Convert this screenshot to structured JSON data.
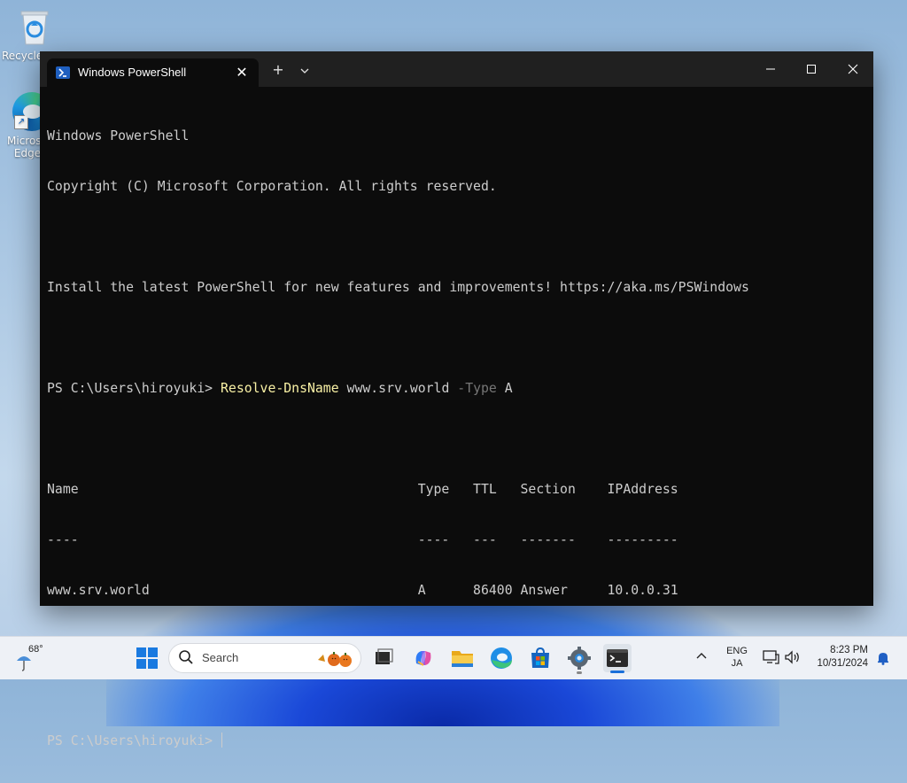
{
  "desktop": {
    "icons": [
      {
        "label": "Recycle Bin"
      },
      {
        "label": "Microsoft Edge"
      }
    ]
  },
  "window": {
    "tab_title": "Windows PowerShell",
    "buttons": {
      "new_tab": "+",
      "dropdown": "⌄",
      "minimize": "—",
      "maximize": "☐",
      "close": "✕"
    }
  },
  "terminal": {
    "banner_line1": "Windows PowerShell",
    "banner_line2": "Copyright (C) Microsoft Corporation. All rights reserved.",
    "install_line": "Install the latest PowerShell for new features and improvements! https://aka.ms/PSWindows",
    "prompt": "PS C:\\Users\\hiroyuki> ",
    "command": {
      "cmdlet": "Resolve-DnsName",
      "arg": " www.srv.world ",
      "param": "-Type",
      "value": " A"
    },
    "table": {
      "header": "Name                                           Type   TTL   Section    IPAddress",
      "divider": "----                                           ----   ---   -------    ---------",
      "rows": [
        "www.srv.world                                  A      86400 Answer     10.0.0.31"
      ]
    },
    "prompt2": "PS C:\\Users\\hiroyuki> "
  },
  "taskbar": {
    "weather_temp": "68°",
    "search_placeholder": "Search",
    "lang_line1": "ENG",
    "lang_line2": "JA",
    "time": "8:23 PM",
    "date": "10/31/2024",
    "apps": [
      "start",
      "search",
      "task-view",
      "copilot",
      "file-explorer",
      "edge",
      "microsoft-store",
      "settings",
      "terminal"
    ]
  },
  "colors": {
    "terminal_bg": "#0c0c0c",
    "terminal_fg": "#cccccc",
    "cmdlet": "#f9f1a5",
    "param": "#767676",
    "titlebar": "#202020",
    "accent": "#1a6fd9"
  }
}
